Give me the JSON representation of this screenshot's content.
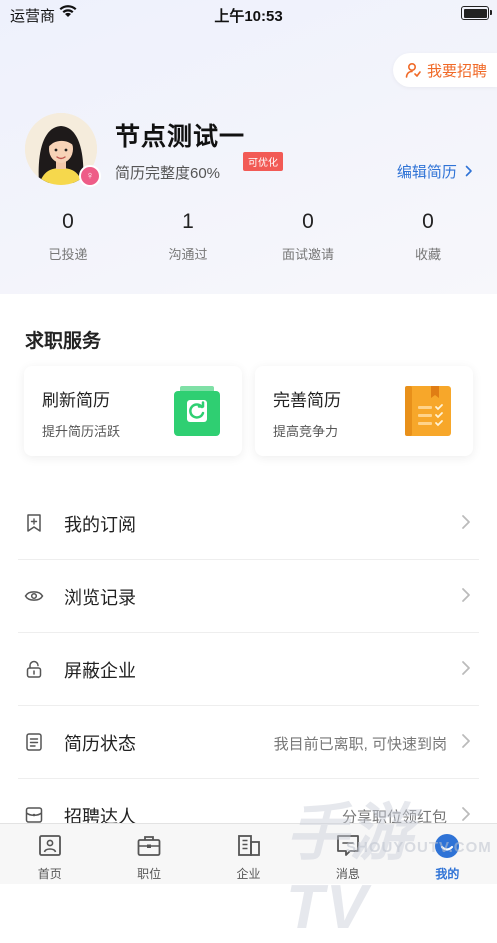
{
  "status_bar": {
    "carrier": "运营商",
    "time": "上午10:53"
  },
  "header": {
    "recruit_label": "我要招聘"
  },
  "profile": {
    "name": "节点测试一",
    "completeness": "简历完整度60%",
    "optimize_badge": "可优化",
    "edit_resume": "编辑简历",
    "gender_symbol": "♀"
  },
  "stats": [
    {
      "value": "0",
      "label": "已投递"
    },
    {
      "value": "1",
      "label": "沟通过"
    },
    {
      "value": "0",
      "label": "面试邀请"
    },
    {
      "value": "0",
      "label": "收藏"
    }
  ],
  "services": {
    "title": "求职服务",
    "cards": [
      {
        "title": "刷新简历",
        "subtitle": "提升简历活跃",
        "icon": "refresh-icon",
        "color": "#2fcf72"
      },
      {
        "title": "完善简历",
        "subtitle": "提高竞争力",
        "icon": "notebook-icon",
        "color": "#f7a72a"
      }
    ]
  },
  "menu": [
    {
      "label": "我的订阅",
      "hint": "",
      "icon": "bookmark-icon"
    },
    {
      "label": "浏览记录",
      "hint": "",
      "icon": "eye-icon"
    },
    {
      "label": "屏蔽企业",
      "hint": "",
      "icon": "lock-icon"
    },
    {
      "label": "简历状态",
      "hint": "我目前已离职, 可快速到岗",
      "icon": "document-icon"
    },
    {
      "label": "招聘达人",
      "hint": "分享职位领红包",
      "icon": "wallet-icon"
    }
  ],
  "tabs": [
    {
      "label": "首页",
      "icon": "home-icon",
      "active": false
    },
    {
      "label": "职位",
      "icon": "briefcase-icon",
      "active": false
    },
    {
      "label": "企业",
      "icon": "building-icon",
      "active": false
    },
    {
      "label": "消息",
      "icon": "message-icon",
      "active": false
    },
    {
      "label": "我的",
      "icon": "profile-icon",
      "active": true
    }
  ],
  "watermark": {
    "main": "手游TV",
    "sub": "SHOUYOUTV.COM"
  },
  "colors": {
    "accent": "#2f73d6",
    "recruit": "#f06a28",
    "badge": "#f25a55"
  }
}
